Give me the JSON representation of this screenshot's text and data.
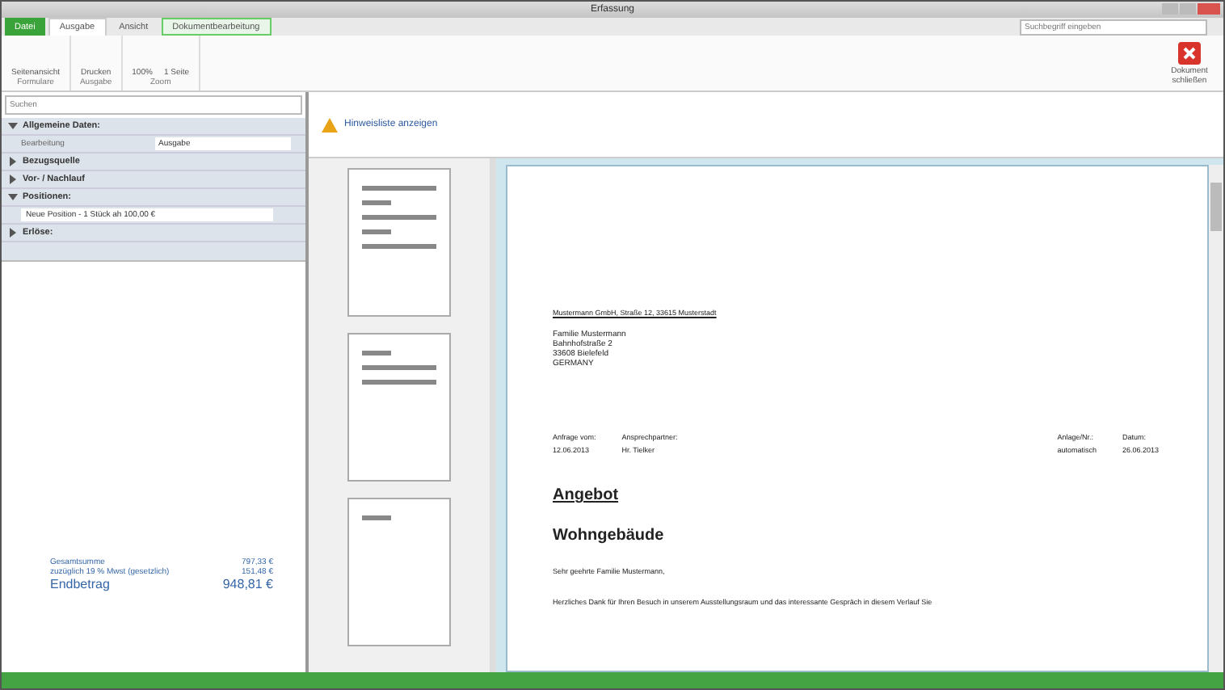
{
  "window": {
    "title": "Erfassung"
  },
  "tabs": [
    {
      "label": "Datei",
      "selected": false,
      "kind": "file"
    },
    {
      "label": "Ausgabe",
      "selected": true,
      "kind": "tab"
    },
    {
      "label": "Ansicht",
      "selected": false,
      "kind": "tab"
    },
    {
      "label": "Dokumentbearbeitung",
      "selected": false,
      "kind": "context"
    }
  ],
  "search": {
    "placeholder": "Suchbegriff eingeben"
  },
  "ribbon": {
    "groups": [
      {
        "label": "Formulare",
        "buttons": [
          "Seitenansicht"
        ]
      },
      {
        "label": "Ausgabe",
        "buttons": [
          "Drucken"
        ]
      },
      {
        "label": "Zoom",
        "buttons": [
          "100%",
          "1 Seite"
        ]
      }
    ],
    "close_label": "Dokument schließen"
  },
  "sidebar": {
    "search_placeholder": "Suchen",
    "items": [
      {
        "label": "Allgemeine Daten:",
        "kind": "section",
        "expanded": true
      },
      {
        "label": "Bearbeitung",
        "kind": "field",
        "value": "Ausgabe"
      },
      {
        "label": "Bezugsquelle",
        "kind": "section",
        "expanded": false
      },
      {
        "label": "Vor- / Nachlauf",
        "kind": "section",
        "expanded": false
      },
      {
        "label": "Positionen:",
        "kind": "section",
        "expanded": true
      },
      {
        "label": "Neue Position - 1 Stück ah 100,00 €",
        "kind": "entry"
      },
      {
        "label": "Erlöse:",
        "kind": "section",
        "expanded": false
      }
    ],
    "totals": [
      {
        "label": "Gesamtsumme",
        "value": "797,33 €",
        "kind": "line"
      },
      {
        "label": "zuzüglich 19 % Mwst (gesetzlich)",
        "value": "151,48 €",
        "kind": "line"
      },
      {
        "label": "Endbetrag",
        "value": "948,81 €",
        "kind": "total"
      }
    ]
  },
  "hint": "Hinweisliste anzeigen",
  "document": {
    "sender": "Mustermann GmbH, Straße 12, 33615 Musterstadt",
    "address": [
      "Familie Mustermann",
      "Bahnhofstraße 2",
      "33608 Bielefeld",
      "GERMANY"
    ],
    "meta": [
      {
        "label": "Anfrage vom:",
        "value": "12.06.2013"
      },
      {
        "label": "Ansprechpartner:",
        "value": "Hr. Tielker"
      },
      {
        "label": "Anlage/Nr.:",
        "value": "automatisch"
      },
      {
        "label": "Datum:",
        "value": "26.06.2013"
      }
    ],
    "title": "Angebot",
    "subtitle": "Wohngebäude",
    "salutation": "Sehr geehrte Familie Mustermann,",
    "body": "Herzliches Dank für Ihren Besuch in unserem Ausstellungsraum und das interessante Gespräch in diesem Verlauf Sie"
  }
}
